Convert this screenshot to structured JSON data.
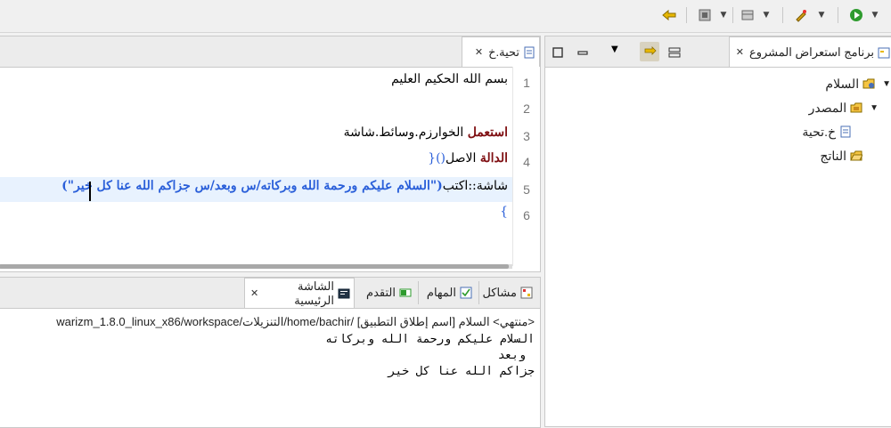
{
  "toolbar": {
    "buttons": [
      {
        "name": "back-icon",
        "glyph": "⇐"
      },
      {
        "name": "gear-icon",
        "glyph": "⚙"
      },
      {
        "name": "build-icon",
        "glyph": "▤"
      },
      {
        "name": "tool-icon",
        "glyph": "✎"
      },
      {
        "name": "run-icon",
        "glyph": "▶"
      }
    ]
  },
  "project_explorer": {
    "tab_label": "برنامج استعراض المشروع",
    "tree": {
      "project": "السلام",
      "source_folder": "المصدر",
      "file": "خ.تحية",
      "output_folder": "الناتج"
    }
  },
  "editor": {
    "tab_label": "تحية.خ",
    "lines": [
      {
        "num": "1",
        "plain": "بسم الله الحكيم العليم"
      },
      {
        "num": "2",
        "plain": ""
      },
      {
        "num": "3",
        "keyword": "استعمل",
        "plain": " الخوارزم.وسائط.شاشة"
      },
      {
        "num": "4",
        "keyword": "الدالة",
        "plain": " الاصل",
        "brace": "(){"
      },
      {
        "num": "5",
        "plain": "شاشة::اكتب",
        "string": "(\"السلام عليكم ورحمة الله وبركاته/س وبعد/س جزاكم الله عنا كل خير\")"
      },
      {
        "num": "6",
        "brace": "}"
      }
    ]
  },
  "bottom_tabs": {
    "problems": "مشاكل",
    "tasks": "المهام",
    "progress": "التقدم",
    "console": "الشاشة الرئيسية"
  },
  "console": {
    "header": "<منتهي> السلام [اسم إطلاق التطبيق] /home/bachir/التنزيلات/warizm_1.8.0_linux_x86/workspace",
    "output": [
      "السلام عليكم ورحمة الله وبركاته",
      "وبعد",
      "جزاكم الله عنا كل خير"
    ]
  }
}
